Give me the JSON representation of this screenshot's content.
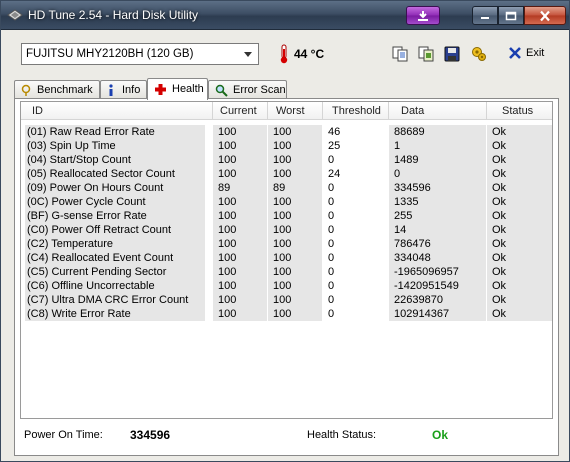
{
  "window": {
    "title": "HD Tune 2.54 - Hard Disk Utility"
  },
  "toolbar": {
    "drive": "FUJITSU MHY2120BH (120 GB)",
    "temperature": "44 °C",
    "exit_label": "Exit",
    "icons": [
      "copy-text-icon",
      "copy-screenshot-icon",
      "save-icon",
      "options-icon"
    ]
  },
  "tabs": [
    {
      "label": "Benchmark",
      "icon": "benchmark-icon"
    },
    {
      "label": "Info",
      "icon": "info-icon"
    },
    {
      "label": "Health",
      "icon": "health-cross-icon",
      "active": true
    },
    {
      "label": "Error Scan",
      "icon": "magnifier-icon"
    }
  ],
  "table": {
    "columns": [
      "ID",
      "Current",
      "Worst",
      "Threshold",
      "Data",
      "Status"
    ],
    "rows": [
      [
        "(01) Raw Read Error Rate",
        "100",
        "100",
        "46",
        "88689",
        "Ok"
      ],
      [
        "(03) Spin Up Time",
        "100",
        "100",
        "25",
        "1",
        "Ok"
      ],
      [
        "(04) Start/Stop Count",
        "100",
        "100",
        "0",
        "1489",
        "Ok"
      ],
      [
        "(05) Reallocated Sector Count",
        "100",
        "100",
        "24",
        "0",
        "Ok"
      ],
      [
        "(09) Power On Hours Count",
        "89",
        "89",
        "0",
        "334596",
        "Ok"
      ],
      [
        "(0C) Power Cycle Count",
        "100",
        "100",
        "0",
        "1335",
        "Ok"
      ],
      [
        "(BF) G-sense Error Rate",
        "100",
        "100",
        "0",
        "255",
        "Ok"
      ],
      [
        "(C0) Power Off Retract Count",
        "100",
        "100",
        "0",
        "14",
        "Ok"
      ],
      [
        "(C2) Temperature",
        "100",
        "100",
        "0",
        "786476",
        "Ok"
      ],
      [
        "(C4) Reallocated Event Count",
        "100",
        "100",
        "0",
        "334048",
        "Ok"
      ],
      [
        "(C5) Current Pending Sector",
        "100",
        "100",
        "0",
        "-1965096957",
        "Ok"
      ],
      [
        "(C6) Offline Uncorrectable",
        "100",
        "100",
        "0",
        "-1420951549",
        "Ok"
      ],
      [
        "(C7) Ultra DMA CRC Error Count",
        "100",
        "100",
        "0",
        "22639870",
        "Ok"
      ],
      [
        "(C8) Write Error Rate",
        "100",
        "100",
        "0",
        "102914367",
        "Ok"
      ]
    ]
  },
  "footer": {
    "power_on_label": "Power On Time:",
    "power_on_value": "334596",
    "health_label": "Health Status:",
    "health_value": "Ok",
    "health_color": "#1aa01a"
  }
}
